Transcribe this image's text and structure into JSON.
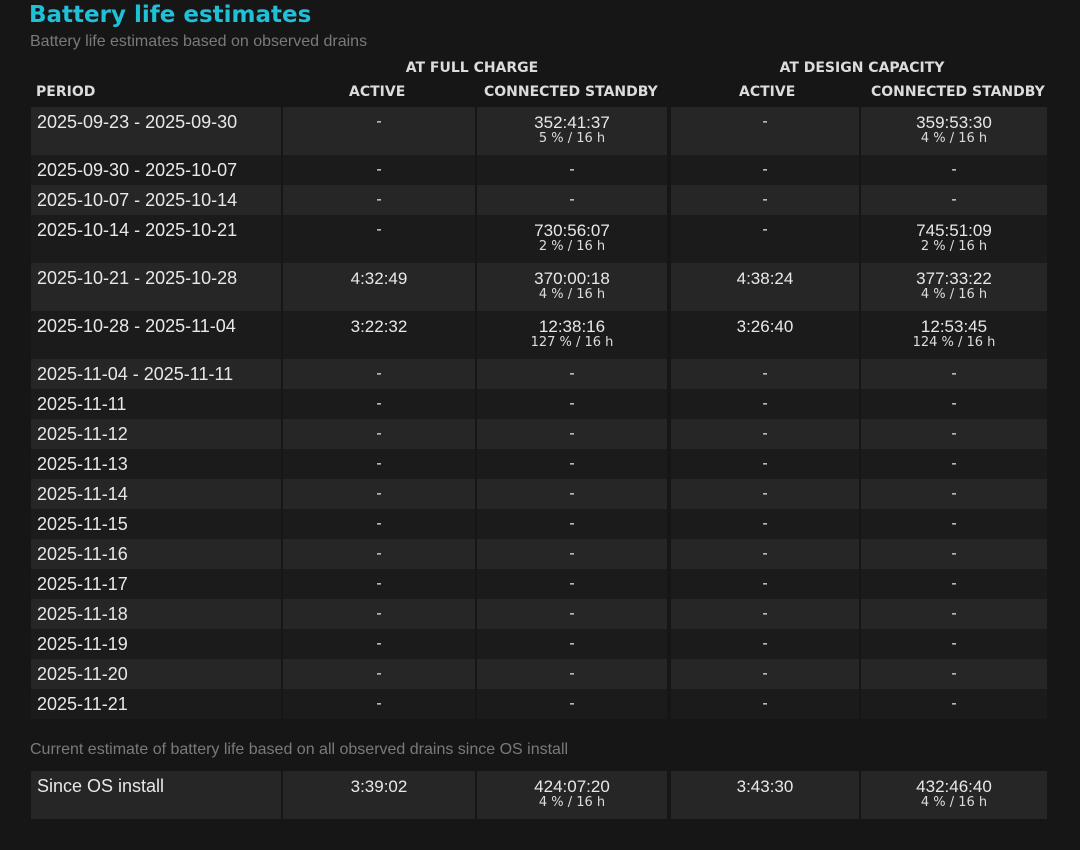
{
  "page": {
    "title": "Battery life estimates",
    "subtitle": "Battery life estimates based on observed drains",
    "section_note": "Current estimate of battery life based on all observed drains since OS install"
  },
  "headers": {
    "group_full": "AT FULL CHARGE",
    "group_design": "AT DESIGN CAPACITY",
    "period": "PERIOD",
    "active_full": "ACTIVE",
    "standby_full": "CONNECTED STANDBY",
    "active_design": "ACTIVE",
    "standby_design": "CONNECTED STANDBY"
  },
  "rows": [
    {
      "period": "2025-09-23 - 2025-09-30",
      "active_full": "-",
      "standby_full": "352:41:37",
      "standby_full_sub": "5 % / 16 h",
      "active_design": "-",
      "standby_design": "359:53:30",
      "standby_design_sub": "4 % / 16 h"
    },
    {
      "period": "2025-09-30 - 2025-10-07",
      "active_full": "-",
      "standby_full": "-",
      "standby_full_sub": "",
      "active_design": "-",
      "standby_design": "-",
      "standby_design_sub": ""
    },
    {
      "period": "2025-10-07 - 2025-10-14",
      "active_full": "-",
      "standby_full": "-",
      "standby_full_sub": "",
      "active_design": "-",
      "standby_design": "-",
      "standby_design_sub": ""
    },
    {
      "period": "2025-10-14 - 2025-10-21",
      "active_full": "-",
      "standby_full": "730:56:07",
      "standby_full_sub": "2 % / 16 h",
      "active_design": "-",
      "standby_design": "745:51:09",
      "standby_design_sub": "2 % / 16 h"
    },
    {
      "period": "2025-10-21 - 2025-10-28",
      "active_full": "4:32:49",
      "standby_full": "370:00:18",
      "standby_full_sub": "4 % / 16 h",
      "active_design": "4:38:24",
      "standby_design": "377:33:22",
      "standby_design_sub": "4 % / 16 h"
    },
    {
      "period": "2025-10-28 - 2025-11-04",
      "active_full": "3:22:32",
      "standby_full": "12:38:16",
      "standby_full_sub": "127 % / 16 h",
      "active_design": "3:26:40",
      "standby_design": "12:53:45",
      "standby_design_sub": "124 % / 16 h"
    },
    {
      "period": "2025-11-04 - 2025-11-11",
      "active_full": "-",
      "standby_full": "-",
      "standby_full_sub": "",
      "active_design": "-",
      "standby_design": "-",
      "standby_design_sub": ""
    },
    {
      "period": "2025-11-11",
      "active_full": "-",
      "standby_full": "-",
      "standby_full_sub": "",
      "active_design": "-",
      "standby_design": "-",
      "standby_design_sub": ""
    },
    {
      "period": "2025-11-12",
      "active_full": "-",
      "standby_full": "-",
      "standby_full_sub": "",
      "active_design": "-",
      "standby_design": "-",
      "standby_design_sub": ""
    },
    {
      "period": "2025-11-13",
      "active_full": "-",
      "standby_full": "-",
      "standby_full_sub": "",
      "active_design": "-",
      "standby_design": "-",
      "standby_design_sub": ""
    },
    {
      "period": "2025-11-14",
      "active_full": "-",
      "standby_full": "-",
      "standby_full_sub": "",
      "active_design": "-",
      "standby_design": "-",
      "standby_design_sub": ""
    },
    {
      "period": "2025-11-15",
      "active_full": "-",
      "standby_full": "-",
      "standby_full_sub": "",
      "active_design": "-",
      "standby_design": "-",
      "standby_design_sub": ""
    },
    {
      "period": "2025-11-16",
      "active_full": "-",
      "standby_full": "-",
      "standby_full_sub": "",
      "active_design": "-",
      "standby_design": "-",
      "standby_design_sub": ""
    },
    {
      "period": "2025-11-17",
      "active_full": "-",
      "standby_full": "-",
      "standby_full_sub": "",
      "active_design": "-",
      "standby_design": "-",
      "standby_design_sub": ""
    },
    {
      "period": "2025-11-18",
      "active_full": "-",
      "standby_full": "-",
      "standby_full_sub": "",
      "active_design": "-",
      "standby_design": "-",
      "standby_design_sub": ""
    },
    {
      "period": "2025-11-19",
      "active_full": "-",
      "standby_full": "-",
      "standby_full_sub": "",
      "active_design": "-",
      "standby_design": "-",
      "standby_design_sub": ""
    },
    {
      "period": "2025-11-20",
      "active_full": "-",
      "standby_full": "-",
      "standby_full_sub": "",
      "active_design": "-",
      "standby_design": "-",
      "standby_design_sub": ""
    },
    {
      "period": "2025-11-21",
      "active_full": "-",
      "standby_full": "-",
      "standby_full_sub": "",
      "active_design": "-",
      "standby_design": "-",
      "standby_design_sub": ""
    }
  ],
  "since_install": {
    "period": "Since OS install",
    "active_full": "3:39:02",
    "standby_full": "424:07:20",
    "standby_full_sub": "4 % / 16 h",
    "active_design": "3:43:30",
    "standby_design": "432:46:40",
    "standby_design_sub": "4 % / 16 h"
  }
}
